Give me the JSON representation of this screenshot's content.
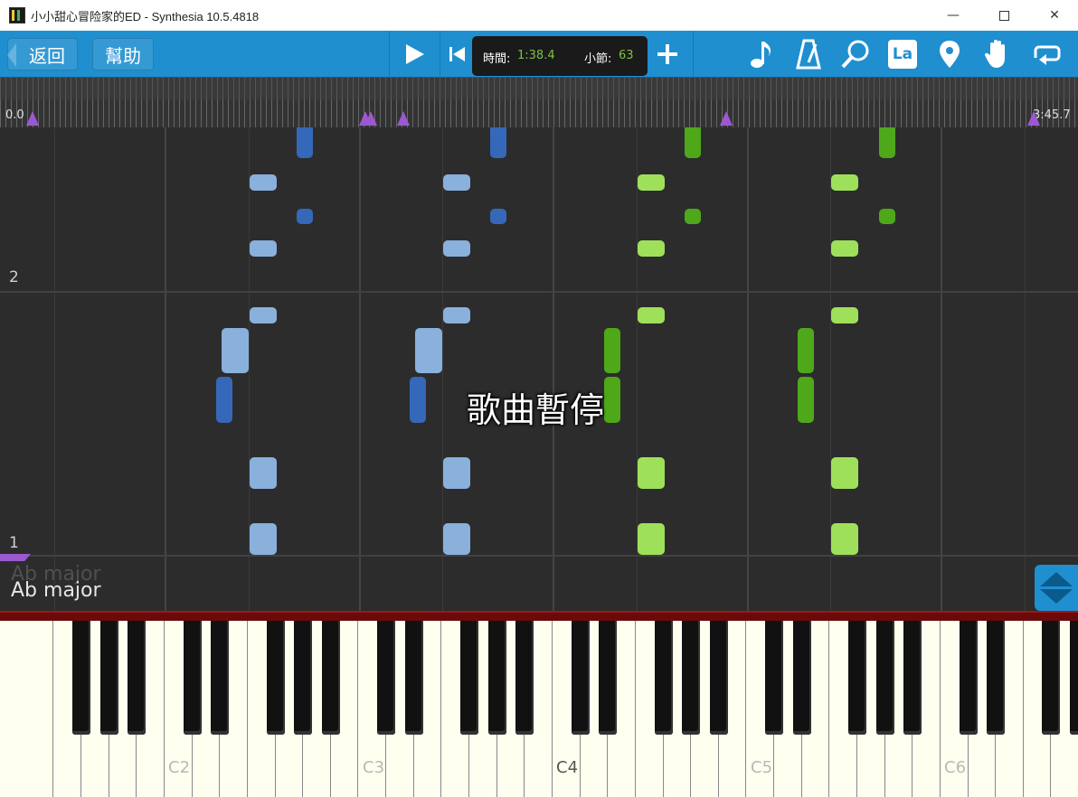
{
  "window": {
    "title": "小小甜心冒险家的ED - Synthesia 10.5.4818",
    "minimize_glyph": "—",
    "close_glyph": "✕"
  },
  "toolbar": {
    "back_label": "返回",
    "help_label": "幫助",
    "time_label": "時間:",
    "time_value": "1:38.4",
    "measure_label": "小節:",
    "measure_value": "63",
    "la_label": "La",
    "icons": [
      "play-icon",
      "skip-to-start-icon",
      "add-icon",
      "music-note-icon",
      "metronome-icon",
      "magnifier-icon",
      "la-solfege-icon",
      "location-pin-icon",
      "hand-icon",
      "loop-icon"
    ]
  },
  "timeline": {
    "start": "0.0",
    "end": "3:45.7"
  },
  "notefield": {
    "measure_2": "2",
    "measure_1": "1",
    "status_text": "歌曲暫停",
    "key_signature": "Ab major"
  },
  "keyboard": {
    "labels": [
      "C2",
      "C3",
      "C4",
      "C5",
      "C6"
    ],
    "highlighted_label": "C4"
  },
  "colors": {
    "accent": "#1f8fd0",
    "right_hand_light": "#8ab0dc",
    "right_hand_dark": "#3568b8",
    "left_hand_light": "#9fe05a",
    "left_hand_dark": "#4ea81a",
    "marker": "#9b59d0"
  }
}
